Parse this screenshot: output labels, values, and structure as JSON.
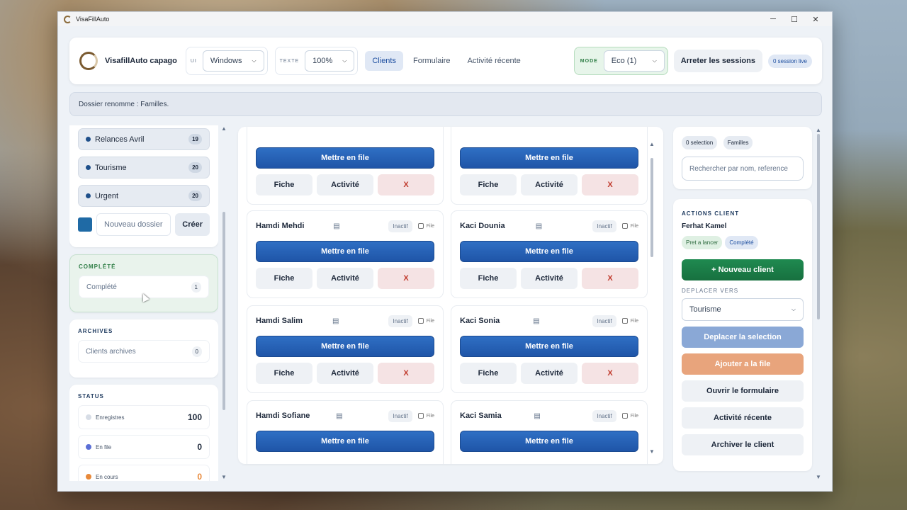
{
  "window": {
    "title": "VisaFillAuto",
    "controls": {
      "minimize": "─",
      "maximize": "☐",
      "close": "✕"
    }
  },
  "header": {
    "brand": "VisafillAuto capago",
    "ui_label": "UI",
    "ui_value": "Windows",
    "text_label": "TEXTE",
    "text_value": "100%",
    "tabs": [
      {
        "label": "Clients",
        "active": true
      },
      {
        "label": "Formulaire"
      },
      {
        "label": "Activité récente"
      }
    ],
    "mode_label": "MODE",
    "mode_value": "Eco (1)",
    "stop_label": "Arreter les sessions",
    "live_label": "0 session live"
  },
  "notice": "Dossier renomme : Familles.",
  "folders": [
    {
      "label": "Relances Avril",
      "count": "19"
    },
    {
      "label": "Tourisme",
      "count": "20"
    },
    {
      "label": "Urgent",
      "count": "20"
    }
  ],
  "new_folder": {
    "placeholder": "Nouveau dossier",
    "button": "Créer",
    "color": "#1f6aa5"
  },
  "complete": {
    "title": "COMPLÉTÉ",
    "item": "Complété",
    "count": "1"
  },
  "archives": {
    "title": "ARCHIVES",
    "item": "Clients archives",
    "count": "0"
  },
  "status": {
    "title": "STATUS",
    "rows": [
      {
        "label": "Enregistres",
        "value": "100",
        "color": "#d7dde6"
      },
      {
        "label": "En file",
        "value": "0",
        "color": "#5b6fd6"
      },
      {
        "label": "En cours",
        "value": "0",
        "color": "#e8893a"
      }
    ]
  },
  "card_labels": {
    "queue": "Mettre en file",
    "fiche": "Fiche",
    "activite": "Activité",
    "remove": "X",
    "inactive": "Inactif",
    "file": "File",
    "icon": "id-card-icon"
  },
  "clients": [
    {
      "name": "",
      "col": 0
    },
    {
      "name": "",
      "col": 1
    },
    {
      "name": "Hamdi Mehdi"
    },
    {
      "name": "Kaci Dounia"
    },
    {
      "name": "Hamdi Salim"
    },
    {
      "name": "Kaci Sonia"
    },
    {
      "name": "Hamdi Sofiane"
    },
    {
      "name": "Kaci Samia"
    }
  ],
  "right": {
    "selection": "0 selection",
    "folder": "Familles",
    "search_placeholder": "Rechercher par nom, reference",
    "actions_title": "ACTIONS CLIENT",
    "client_name": "Ferhat Kamel",
    "tag_ready": "Pret a lancer",
    "tag_done": "Complété",
    "new_client": "+ Nouveau client",
    "move_title": "DEPLACER VERS",
    "move_value": "Tourisme",
    "buttons": [
      "Deplacer la selection",
      "Ajouter a la file",
      "Ouvrir le formulaire",
      "Activité récente",
      "Archiver le client"
    ]
  }
}
